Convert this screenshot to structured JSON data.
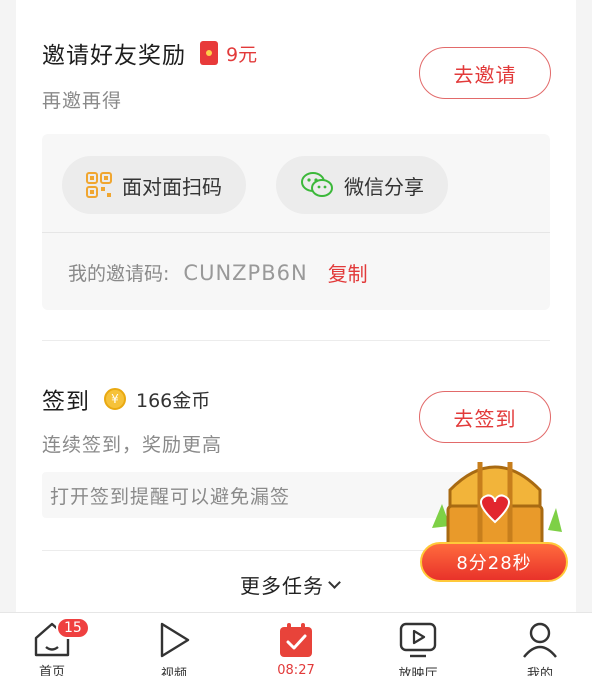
{
  "invite": {
    "title": "邀请好友奖励",
    "reward": "9元",
    "subtitle": "再邀再得",
    "button": "去邀请",
    "share_face_to_face": "面对面扫码",
    "share_wechat": "微信分享",
    "code_label": "我的邀请码:",
    "code_value": "CUNZPB6N",
    "copy_label": "复制"
  },
  "signin": {
    "title": "签到",
    "coin_symbol": "¥",
    "reward": "166金币",
    "subtitle": "连续签到，奖励更高",
    "button": "去签到",
    "reminder": "打开签到提醒可以避免漏签"
  },
  "more_tasks": "更多任务",
  "chest": {
    "timer": "8分28秒"
  },
  "tabbar": {
    "items": [
      {
        "label": "首页",
        "icon": "home-icon",
        "badge": "15"
      },
      {
        "label": "视频",
        "icon": "play-icon"
      },
      {
        "label": "08:27",
        "icon": "calendar-check-icon",
        "active": true
      },
      {
        "label": "放映厅",
        "icon": "tv-play-icon"
      },
      {
        "label": "我的",
        "icon": "user-icon"
      }
    ]
  },
  "colors": {
    "accent": "#e23a3a",
    "gold": "#f6c23a"
  }
}
